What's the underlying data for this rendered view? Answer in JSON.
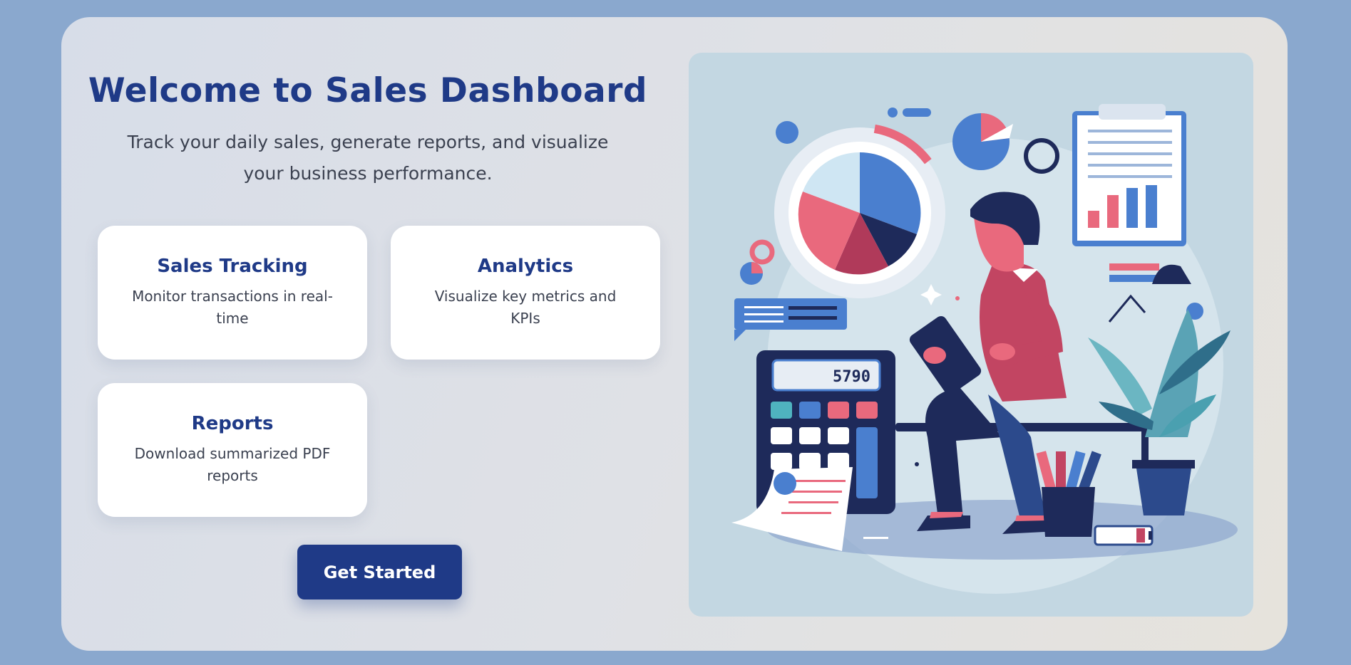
{
  "hero": {
    "title": "Welcome to Sales Dashboard",
    "subtitle": "Track your daily sales, generate reports, and visualize your business performance."
  },
  "features": [
    {
      "title": "Sales Tracking",
      "description": "Monitor transactions in real-time"
    },
    {
      "title": "Analytics",
      "description": "Visualize key metrics and KPIs"
    },
    {
      "title": "Reports",
      "description": "Download summarized PDF reports"
    }
  ],
  "cta": {
    "label": "Get Started"
  },
  "illustration": {
    "calculator_display": "5790"
  },
  "colors": {
    "page_background": "#8aa8ce",
    "primary": "#1f3a87",
    "card_background": "#ffffff",
    "body_text": "#3b4150",
    "illustration_background": "#c3d7e2",
    "accent_red": "#e9697d",
    "accent_blue": "#4a7fcf"
  }
}
